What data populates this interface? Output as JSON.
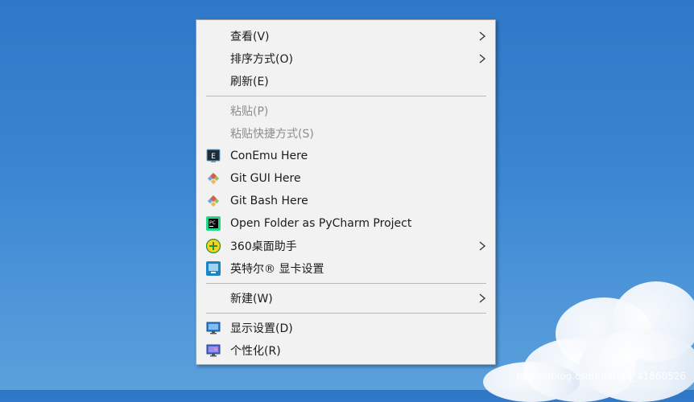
{
  "menu": {
    "items": [
      {
        "label": "查看(V)",
        "submenu": true
      },
      {
        "label": "排序方式(O)",
        "submenu": true
      },
      {
        "label": "刷新(E)"
      },
      {
        "label": "粘贴(P)",
        "disabled": true
      },
      {
        "label": "粘贴快捷方式(S)",
        "disabled": true
      },
      {
        "label": "ConEmu Here",
        "icon": "conemu-icon"
      },
      {
        "label": "Git GUI Here",
        "icon": "git-icon"
      },
      {
        "label": "Git Bash Here",
        "icon": "git-icon"
      },
      {
        "label": "Open Folder as PyCharm Project",
        "icon": "pycharm-icon"
      },
      {
        "label": "360桌面助手",
        "icon": "360-assistant-icon",
        "submenu": true
      },
      {
        "label": "英特尔® 显卡设置",
        "icon": "intel-graphics-icon"
      },
      {
        "label": "新建(W)",
        "submenu": true
      },
      {
        "label": "显示设置(D)",
        "icon": "display-settings-icon"
      },
      {
        "label": "个性化(R)",
        "icon": "personalize-icon"
      }
    ]
  },
  "watermark": "https://blog.csdn.net/qq_41860526",
  "colors": {
    "menu_bg": "#f2f2f2",
    "disabled_text": "#8d8d8d",
    "desktop_blue": "#3a86d2"
  }
}
